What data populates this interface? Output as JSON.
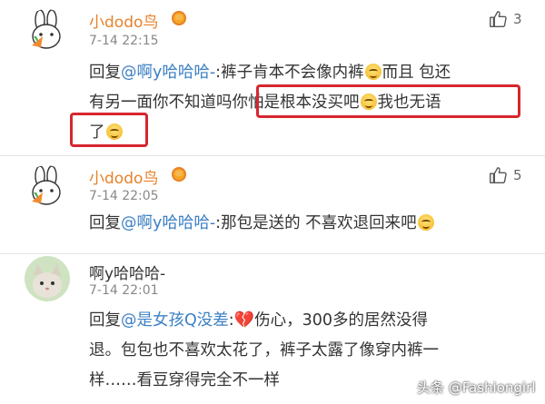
{
  "comments": [
    {
      "name": "小dodo鸟",
      "time": "7-14 22:15",
      "likes": "3",
      "reply_prefix": "回复",
      "mention": "@啊y哈哈哈-",
      "line1_rest": ":裤子肯本不会像内裤",
      "line1_end": "而且 包还",
      "line2_start": "有另一面你不知道吗",
      "line2_hl": "你怕是根本没买吧",
      "line2_end": "我也无语",
      "line3": "了"
    },
    {
      "name": "小dodo鸟",
      "time": "7-14 22:05",
      "likes": "5",
      "reply_prefix": "回复",
      "mention": "@啊y哈哈哈-",
      "text": ":那包是送的 不喜欢退回来吧"
    },
    {
      "name": "啊y哈哈哈-",
      "time": "7-14 22:01",
      "reply_prefix": "回复",
      "mention": "@是女孩Q没差",
      "line1_a": ":",
      "line1_b": "伤心，300多的居然没得",
      "line2": "退。包包也不喜欢太花了，裤子太露了像穿内裤一",
      "line3": "样……看豆穿得完全不一样"
    }
  ],
  "icons": {
    "like": "thumbs-up-icon",
    "vip": "vip-badge-icon",
    "emoji": "smile-emoji-icon",
    "heart": "broken-heart-icon"
  },
  "watermark": "头条 @Fashiongirl",
  "colors": {
    "name_orange": "#e8822a",
    "link_blue": "#3b7fc4",
    "highlight_red": "#d7262f"
  }
}
